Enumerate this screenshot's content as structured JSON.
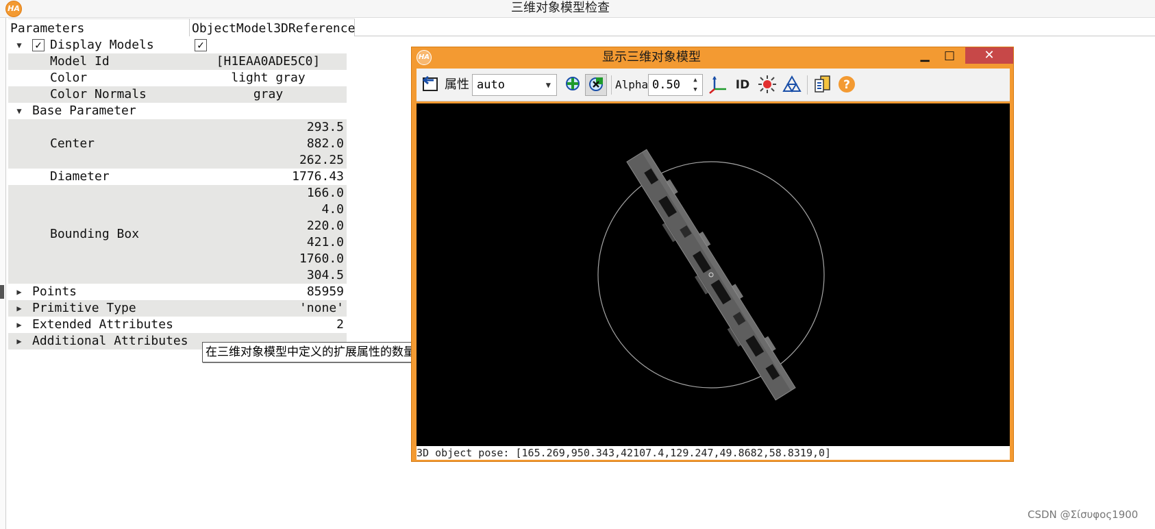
{
  "main_window": {
    "logo_text": "HA",
    "title": "三维对象模型检查"
  },
  "table": {
    "headers": [
      "Parameters",
      "ObjectModel3DReference"
    ],
    "display_models": {
      "label": "Display Models",
      "checked": "✓",
      "value_checked": "✓"
    },
    "model_id": {
      "label": "Model Id",
      "value": "[H1EAA0ADE5C0]"
    },
    "color": {
      "label": "Color",
      "value": "light gray"
    },
    "color_normals": {
      "label": "Color Normals",
      "value": "gray"
    },
    "base_parameter": {
      "label": "Base Parameter"
    },
    "center": {
      "label": "Center",
      "values": [
        "293.5",
        "882.0",
        "262.25"
      ]
    },
    "diameter": {
      "label": "Diameter",
      "value": "1776.43"
    },
    "bounding_box": {
      "label": "Bounding Box",
      "values": [
        "166.0",
        "4.0",
        "220.0",
        "421.0",
        "1760.0",
        "304.5"
      ]
    },
    "points": {
      "label": "Points",
      "value": "85959"
    },
    "primitive_type": {
      "label": "Primitive Type",
      "value": "'none'"
    },
    "extended_attributes": {
      "label": "Extended Attributes",
      "value": "2"
    },
    "additional_attributes": {
      "label": "Additional Attributes"
    }
  },
  "tooltip": "在三维对象模型中定义的扩展属性的数量",
  "model_window": {
    "logo_text": "HA",
    "title": "显示三维对象模型",
    "min_glyph": "▁",
    "max_glyph": "□",
    "close_glyph": "✕",
    "toolbar": {
      "properties_label": "属性",
      "select_value": "auto",
      "alpha_label": "Alpha",
      "alpha_value": "0.50",
      "id_label": "ID"
    },
    "status": "3D object pose: [165.269,950.343,42107.4,129.247,49.8682,58.8319,0]"
  },
  "watermark": "CSDN @Σίσυφος1900",
  "colors": {
    "accent_orange": "#f39a32",
    "close_red": "#c74848",
    "row_alt": "#e6e6e4",
    "viewport_bg": "#000000"
  },
  "icons": [
    "reset-view-icon",
    "dropdown-arrow-icon",
    "add-model-icon",
    "select-model-icon",
    "spin-up-icon",
    "spin-down-icon",
    "axes-icon",
    "id-icon",
    "light-icon",
    "mesh-icon",
    "export-icon",
    "help-icon"
  ]
}
